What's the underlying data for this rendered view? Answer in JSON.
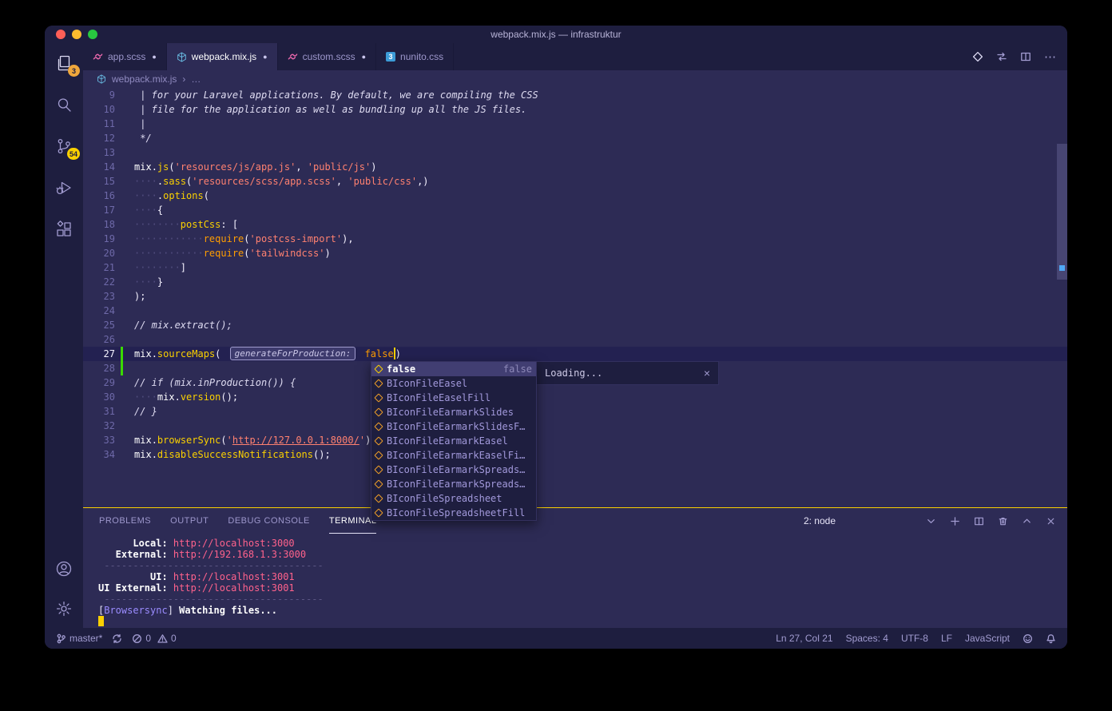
{
  "window": {
    "title": "webpack.mix.js — infrastruktur"
  },
  "glyphs": {
    "modified_dot": "●",
    "chevron": "›",
    "ellipsis": "⋯",
    "close": "×"
  },
  "activity_bar": {
    "explorer_badge": "3",
    "scm_badge": "54"
  },
  "tabs": [
    {
      "label": "app.scss",
      "icon": "scss",
      "modified": true,
      "active": false
    },
    {
      "label": "webpack.mix.js",
      "icon": "webpack",
      "modified": true,
      "active": true
    },
    {
      "label": "custom.scss",
      "icon": "scss",
      "modified": true,
      "active": false
    },
    {
      "label": "nunito.css",
      "icon": "css3",
      "modified": false,
      "active": false
    }
  ],
  "breadcrumb": {
    "file": "webpack.mix.js",
    "more": "…"
  },
  "editor": {
    "lines": [
      {
        "n": "9",
        "seg": [
          {
            "t": " | for your Laravel applications. By default, we are compiling the CSS",
            "s": "cm"
          }
        ]
      },
      {
        "n": "10",
        "seg": [
          {
            "t": " | file for the application as well as bundling up all the JS files.",
            "s": "cm"
          }
        ]
      },
      {
        "n": "11",
        "seg": [
          {
            "t": " |",
            "s": "cm"
          }
        ]
      },
      {
        "n": "12",
        "seg": [
          {
            "t": " */",
            "s": "cm"
          }
        ]
      },
      {
        "n": "13",
        "seg": []
      },
      {
        "n": "14",
        "seg": [
          {
            "t": "mix",
            "s": "pl"
          },
          {
            "t": ".",
            "s": "pun"
          },
          {
            "t": "js",
            "s": "fn"
          },
          {
            "t": "(",
            "s": "pun"
          },
          {
            "t": "'resources/js/app.js'",
            "s": "str"
          },
          {
            "t": ", ",
            "s": "pun"
          },
          {
            "t": "'public/js'",
            "s": "str"
          },
          {
            "t": ")",
            "s": "pun"
          }
        ]
      },
      {
        "n": "15",
        "seg": [
          {
            "t": "····",
            "s": "ws"
          },
          {
            "t": ".",
            "s": "pun"
          },
          {
            "t": "sass",
            "s": "fn"
          },
          {
            "t": "(",
            "s": "pun"
          },
          {
            "t": "'resources/scss/app.scss'",
            "s": "str"
          },
          {
            "t": ", ",
            "s": "pun"
          },
          {
            "t": "'public/css'",
            "s": "str"
          },
          {
            "t": ",)",
            "s": "pun"
          }
        ]
      },
      {
        "n": "16",
        "seg": [
          {
            "t": "····",
            "s": "ws"
          },
          {
            "t": ".",
            "s": "pun"
          },
          {
            "t": "options",
            "s": "fn"
          },
          {
            "t": "(",
            "s": "pun"
          }
        ]
      },
      {
        "n": "17",
        "seg": [
          {
            "t": "····",
            "s": "ws"
          },
          {
            "t": "{",
            "s": "pun"
          }
        ]
      },
      {
        "n": "18",
        "seg": [
          {
            "t": "········",
            "s": "ws"
          },
          {
            "t": "postCss",
            "s": "prop"
          },
          {
            "t": ": [",
            "s": "pun"
          }
        ]
      },
      {
        "n": "19",
        "seg": [
          {
            "t": "············",
            "s": "ws"
          },
          {
            "t": "require",
            "s": "req"
          },
          {
            "t": "(",
            "s": "pun"
          },
          {
            "t": "'postcss-import'",
            "s": "str"
          },
          {
            "t": "),",
            "s": "pun"
          }
        ]
      },
      {
        "n": "20",
        "seg": [
          {
            "t": "············",
            "s": "ws"
          },
          {
            "t": "require",
            "s": "req"
          },
          {
            "t": "(",
            "s": "pun"
          },
          {
            "t": "'tailwindcss'",
            "s": "str"
          },
          {
            "t": ")",
            "s": "pun"
          }
        ]
      },
      {
        "n": "21",
        "seg": [
          {
            "t": "········",
            "s": "ws"
          },
          {
            "t": "]",
            "s": "pun"
          }
        ]
      },
      {
        "n": "22",
        "seg": [
          {
            "t": "····",
            "s": "ws"
          },
          {
            "t": "}",
            "s": "pun"
          }
        ]
      },
      {
        "n": "23",
        "seg": [
          {
            "t": ");",
            "s": "pun"
          }
        ]
      },
      {
        "n": "24",
        "seg": []
      },
      {
        "n": "25",
        "seg": [
          {
            "t": "// mix.extract();",
            "s": "cm"
          }
        ]
      },
      {
        "n": "26",
        "seg": []
      },
      {
        "n": "27",
        "current": true,
        "seg": [
          {
            "t": "mix",
            "s": "pl"
          },
          {
            "t": ".",
            "s": "pun"
          },
          {
            "t": "sourceMaps",
            "s": "fn"
          },
          {
            "t": "( ",
            "s": "pun"
          },
          {
            "t": "generateForProduction:",
            "s": "hint"
          },
          {
            "t": " ",
            "s": "pl"
          },
          {
            "t": "false",
            "s": "kw"
          },
          {
            "t": "",
            "s": "caret"
          },
          {
            "t": ")",
            "s": "pun"
          }
        ]
      },
      {
        "n": "28",
        "seg": []
      },
      {
        "n": "29",
        "seg": [
          {
            "t": "// if (mix.inProduction()) {",
            "s": "cm"
          }
        ]
      },
      {
        "n": "30",
        "seg": [
          {
            "t": "····",
            "s": "ws"
          },
          {
            "t": "mix",
            "s": "pl"
          },
          {
            "t": ".",
            "s": "pun"
          },
          {
            "t": "version",
            "s": "fn"
          },
          {
            "t": "();",
            "s": "pun"
          }
        ]
      },
      {
        "n": "31",
        "seg": [
          {
            "t": "// }",
            "s": "cm"
          }
        ]
      },
      {
        "n": "32",
        "seg": []
      },
      {
        "n": "33",
        "seg": [
          {
            "t": "mix",
            "s": "pl"
          },
          {
            "t": ".",
            "s": "pun"
          },
          {
            "t": "browserSync",
            "s": "fn"
          },
          {
            "t": "(",
            "s": "pun"
          },
          {
            "t": "'",
            "s": "str"
          },
          {
            "t": "http://127.0.0.1:8000/",
            "s": "lnk"
          },
          {
            "t": "'",
            "s": "str"
          },
          {
            "t": ")",
            "s": "pun"
          }
        ]
      },
      {
        "n": "34",
        "seg": [
          {
            "t": "mix",
            "s": "pl"
          },
          {
            "t": ".",
            "s": "pun"
          },
          {
            "t": "disableSuccessNotifications",
            "s": "fn"
          },
          {
            "t": "();",
            "s": "pun"
          }
        ]
      }
    ]
  },
  "suggest": {
    "status": "Loading...",
    "items": [
      {
        "label": "false",
        "detail": "false",
        "selected": true
      },
      {
        "label": "BIconFileEasel"
      },
      {
        "label": "BIconFileEaselFill"
      },
      {
        "label": "BIconFileEarmarkSlides"
      },
      {
        "label": "BIconFileEarmarkSlidesF…"
      },
      {
        "label": "BIconFileEarmarkEasel"
      },
      {
        "label": "BIconFileEarmarkEaselFi…"
      },
      {
        "label": "BIconFileEarmarkSpreads…"
      },
      {
        "label": "BIconFileEarmarkSpreads…"
      },
      {
        "label": "BIconFileSpreadsheet"
      },
      {
        "label": "BIconFileSpreadsheetFill"
      }
    ]
  },
  "panel": {
    "tabs": [
      {
        "label": "PROBLEMS",
        "active": false
      },
      {
        "label": "OUTPUT",
        "active": false
      },
      {
        "label": "DEBUG CONSOLE",
        "active": false
      },
      {
        "label": "TERMINAL",
        "active": true
      }
    ],
    "terminal_picker": "2: node",
    "terminal": {
      "lines": [
        {
          "seg": [
            {
              "t": "      Local: ",
              "s": "tl"
            },
            {
              "t": "http://localhost:3000",
              "s": "tu"
            }
          ]
        },
        {
          "seg": [
            {
              "t": "   External: ",
              "s": "tl"
            },
            {
              "t": "http://192.168.1.3:3000",
              "s": "tu"
            }
          ]
        },
        {
          "seg": [
            {
              "t": " --------------------------------------",
              "s": "ts"
            }
          ]
        },
        {
          "seg": [
            {
              "t": "         UI: ",
              "s": "tl"
            },
            {
              "t": "http://localhost:3001",
              "s": "tu"
            }
          ]
        },
        {
          "seg": [
            {
              "t": "UI External: ",
              "s": "tl"
            },
            {
              "t": "http://localhost:3001",
              "s": "tu"
            }
          ]
        },
        {
          "seg": [
            {
              "t": " --------------------------------------",
              "s": "ts"
            }
          ]
        },
        {
          "seg": [
            {
              "t": "[",
              "s": "tp"
            },
            {
              "t": "Browsersync",
              "s": "tn"
            },
            {
              "t": "] ",
              "s": "tp"
            },
            {
              "t": "Watching files...",
              "s": "tb"
            }
          ]
        },
        {
          "seg": [
            {
              "s": "tcursor",
              "t": ""
            }
          ]
        }
      ]
    }
  },
  "status_bar": {
    "branch": "master*",
    "errors": "0",
    "warnings": "0",
    "line_col": "Ln 27, Col 21",
    "spaces": "Spaces: 4",
    "encoding": "UTF-8",
    "eol": "LF",
    "language": "JavaScript"
  }
}
